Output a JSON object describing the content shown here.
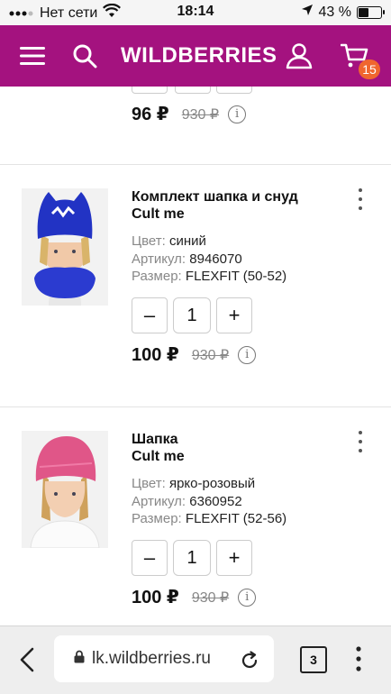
{
  "status_bar": {
    "carrier": "Нет сети",
    "time": "18:14",
    "battery": "43 %",
    "battery_level": 0.43
  },
  "header": {
    "logo": "WILDBERRIES",
    "cart_count": "15",
    "brand_color": "#a4127f",
    "badge_color": "#f0662f",
    "icons": [
      "hamburger-menu-icon",
      "search-icon",
      "user-icon",
      "cart-icon"
    ]
  },
  "previous_item": {
    "price": "96 ₽",
    "old_price": "930 ₽",
    "info": "i"
  },
  "products": [
    {
      "title": "Комплект шапка и снуд",
      "brand": "Cult me",
      "color_label": "Цвет:",
      "color_value": "синий",
      "article_label": "Артикул:",
      "article_value": "8946070",
      "size_label": "Размер:",
      "size_value": "FLEXFIT (50-52)",
      "quantity": "1",
      "minus": "–",
      "plus": "+",
      "price": "100 ₽",
      "old_price": "930 ₽",
      "info": "i"
    },
    {
      "title": "Шапка",
      "brand": "Cult me",
      "color_label": "Цвет:",
      "color_value": "ярко-розовый",
      "article_label": "Артикул:",
      "article_value": "6360952",
      "size_label": "Размер:",
      "size_value": "FLEXFIT (52-56)",
      "quantity": "1",
      "minus": "–",
      "plus": "+",
      "price": "100 ₽",
      "old_price": "930 ₽",
      "info": "i"
    }
  ],
  "browser": {
    "url": "lk.wildberries.ru",
    "tabs_count": "3"
  }
}
